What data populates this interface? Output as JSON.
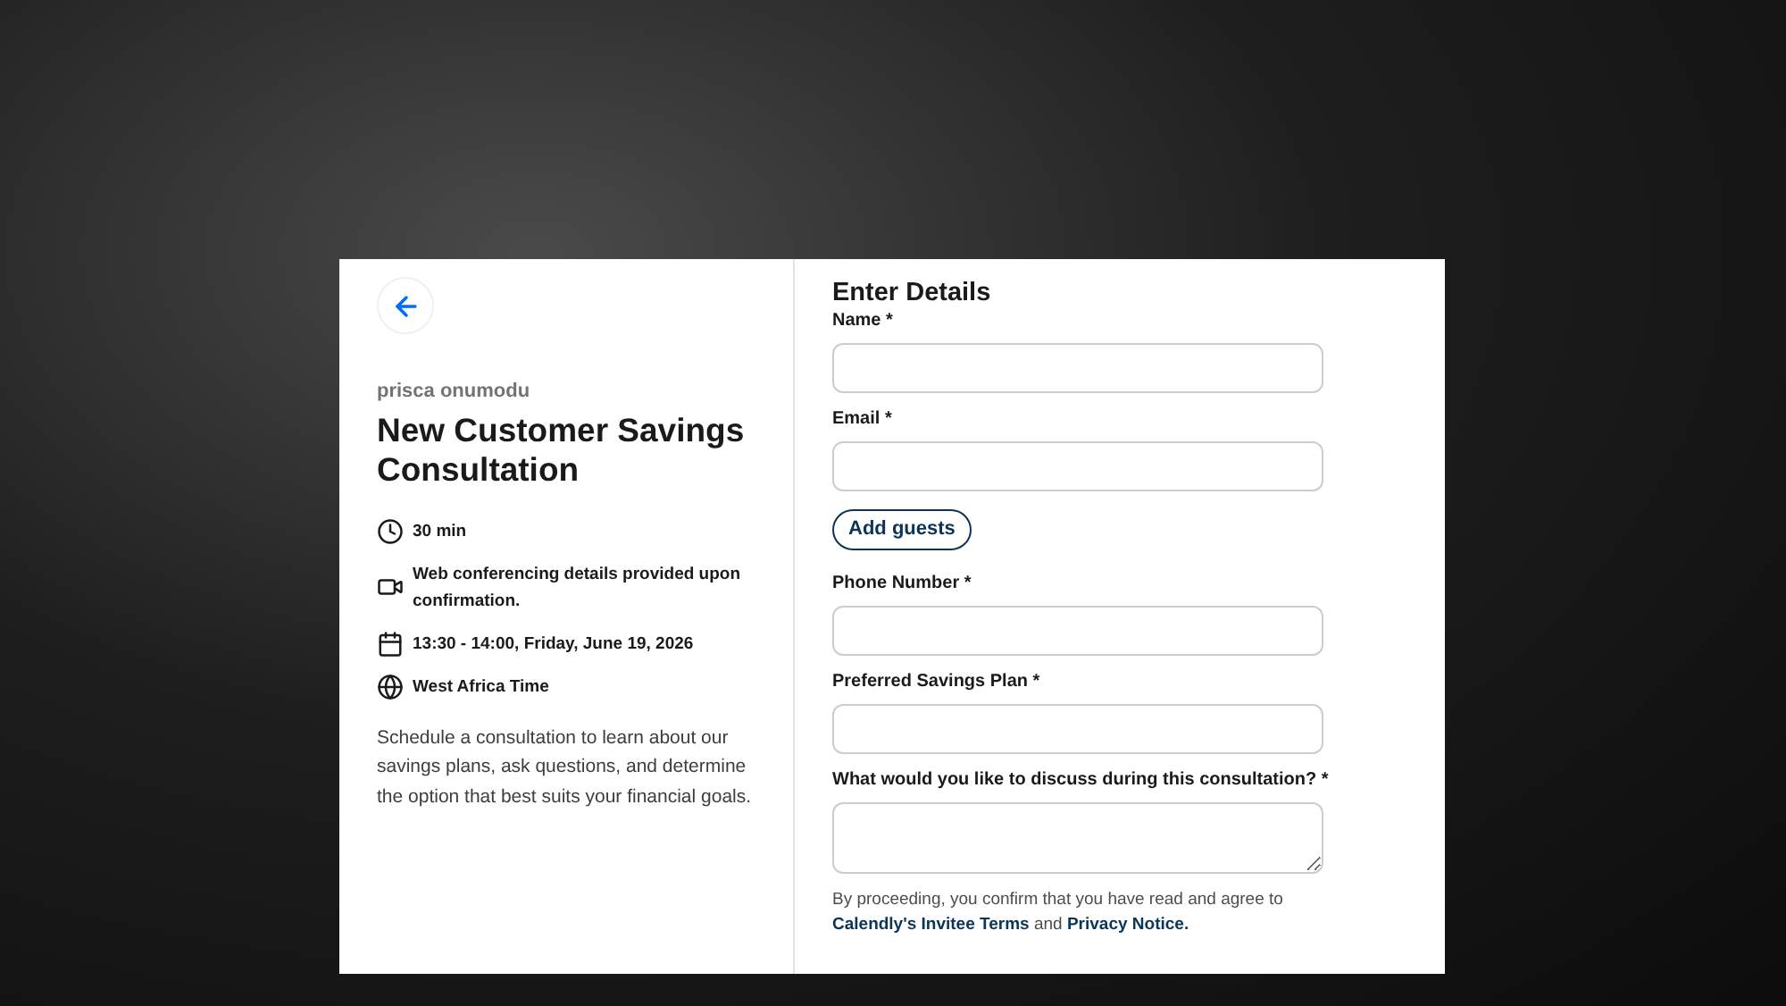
{
  "organizer": "prisca onumodu",
  "event_title": "New Customer Savings Consultation",
  "details": [
    {
      "kind": "duration",
      "text": "30 min"
    },
    {
      "kind": "video",
      "text": "Web conferencing details provided upon confirmation."
    },
    {
      "kind": "calendar",
      "text": "13:30 - 14:00, Friday, June 19, 2026"
    },
    {
      "kind": "timezone",
      "text": "West Africa Time"
    }
  ],
  "description": "Schedule a consultation to learn about our savings plans, ask questions, and determine the option that best suits your financial goals.",
  "form": {
    "heading": "Enter Details",
    "fields": [
      {
        "kind": "input",
        "label": "Name *"
      },
      {
        "kind": "input",
        "label": "Email *"
      },
      {
        "kind": "button",
        "label": "Add guests"
      },
      {
        "kind": "input",
        "label": "Phone Number *"
      },
      {
        "kind": "input",
        "label": "Preferred Savings Plan *"
      },
      {
        "kind": "textarea",
        "label": "What would you like to discuss during this consultation? *"
      }
    ],
    "consent": {
      "text": "By proceeding, you confirm that you have read and agree to",
      "link_1": "Calendly's Invitee Terms",
      "joiner": "and",
      "link_2": "Privacy Notice."
    }
  }
}
